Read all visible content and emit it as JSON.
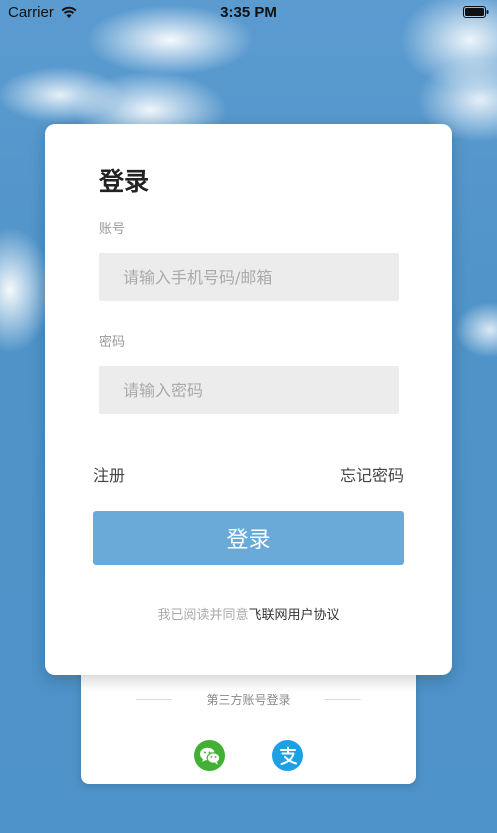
{
  "status_bar": {
    "carrier": "Carrier",
    "time": "3:35 PM"
  },
  "login": {
    "title": "登录",
    "account_label": "账号",
    "account_placeholder": "请输入手机号码/邮箱",
    "password_label": "密码",
    "password_placeholder": "请输入密码",
    "register_link": "注册",
    "forgot_link": "忘记密码",
    "submit_label": "登录",
    "agreement_prefix": "我已阅读并同意",
    "agreement_link": "飞联网用户协议"
  },
  "third_party": {
    "label": "第三方账号登录",
    "icons": [
      "wechat-icon",
      "alipay-icon"
    ]
  },
  "colors": {
    "accent": "#6aaad8",
    "wechat": "#41b035",
    "alipay": "#1ea0e4"
  }
}
